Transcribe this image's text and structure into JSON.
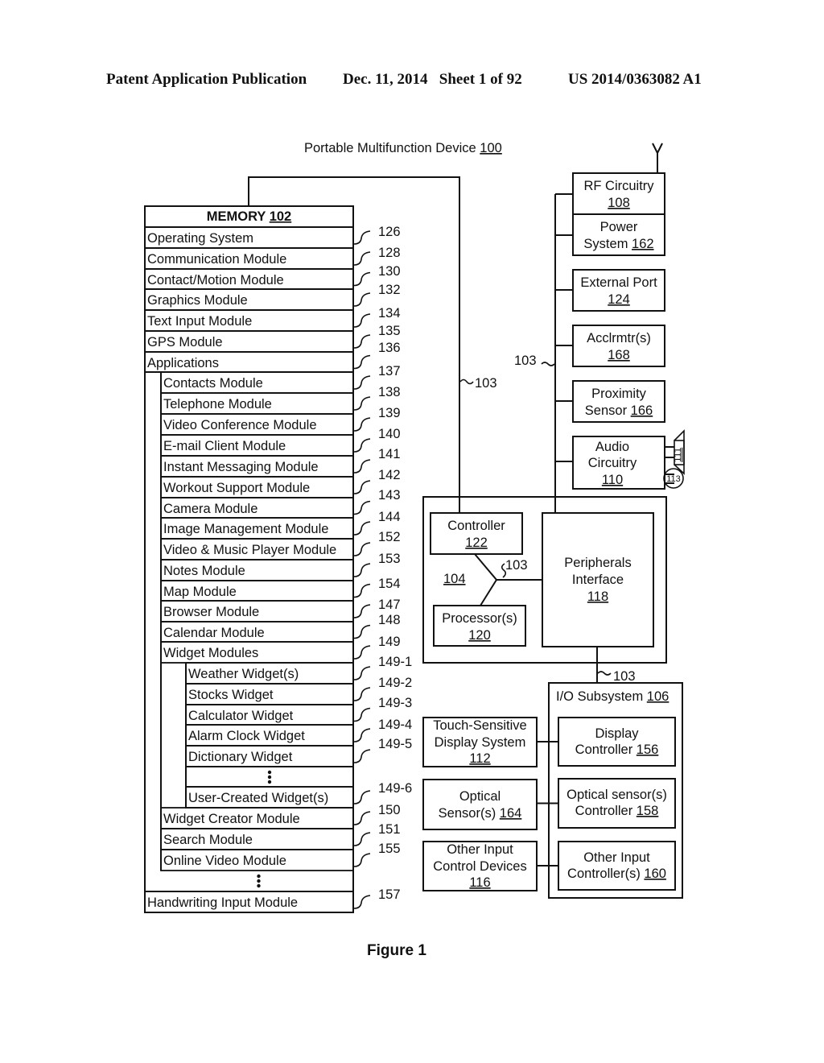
{
  "header": {
    "left": "Patent Application Publication",
    "date_sheet": "Dec. 11, 2014   Sheet 1 of 92",
    "pub_number": "US 2014/0363082 A1"
  },
  "diagram": {
    "title_text": "Portable Multifunction Device ",
    "title_ref": "100",
    "memory": {
      "title_text": "MEMORY ",
      "title_ref": "102",
      "rows": [
        {
          "label": "Operating System",
          "ref": "126",
          "level": 0
        },
        {
          "label": "Communication Module",
          "ref": "128",
          "level": 0
        },
        {
          "label": "Contact/Motion Module",
          "ref": "130",
          "level": 0
        },
        {
          "label": "Graphics Module",
          "ref": "132",
          "level": 0
        },
        {
          "label": "Text Input Module",
          "ref": "134",
          "level": 0
        },
        {
          "label": "GPS Module",
          "ref": "135",
          "level": 0
        },
        {
          "label": "Applications",
          "ref": "136",
          "level": 0
        },
        {
          "label": "Contacts Module",
          "ref": "137",
          "level": 1
        },
        {
          "label": "Telephone Module",
          "ref": "138",
          "level": 1
        },
        {
          "label": "Video Conference Module",
          "ref": "139",
          "level": 1
        },
        {
          "label": "E-mail Client Module",
          "ref": "140",
          "level": 1
        },
        {
          "label": "Instant Messaging Module",
          "ref": "141",
          "level": 1
        },
        {
          "label": "Workout Support Module",
          "ref": "142",
          "level": 1
        },
        {
          "label": "Camera Module",
          "ref": "143",
          "level": 1
        },
        {
          "label": "Image Management Module",
          "ref": "144",
          "level": 1
        },
        {
          "label": "Video & Music Player Module",
          "ref": "152",
          "level": 1
        },
        {
          "label": "Notes Module",
          "ref": "153",
          "level": 1
        },
        {
          "label": "Map Module",
          "ref": "154",
          "level": 1
        },
        {
          "label": "Browser Module",
          "ref": "147",
          "level": 1
        },
        {
          "label": "Calendar Module",
          "ref": "148",
          "level": 1
        },
        {
          "label": "Widget Modules",
          "ref": "149",
          "level": 1
        },
        {
          "label": "Weather Widget(s)",
          "ref": "149-1",
          "level": 2
        },
        {
          "label": "Stocks Widget",
          "ref": "149-2",
          "level": 2
        },
        {
          "label": "Calculator Widget",
          "ref": "149-3",
          "level": 2
        },
        {
          "label": "Alarm Clock Widget",
          "ref": "149-4",
          "level": 2
        },
        {
          "label": "Dictionary Widget",
          "ref": "149-5",
          "level": 2
        },
        {
          "label": "⋮",
          "ref": "",
          "level": 2
        },
        {
          "label": "User-Created Widget(s)",
          "ref": "149-6",
          "level": 2
        },
        {
          "label": "Widget Creator Module",
          "ref": "150",
          "level": 1
        },
        {
          "label": "Search Module",
          "ref": "151",
          "level": 1
        },
        {
          "label": "Online Video Module",
          "ref": "155",
          "level": 1
        },
        {
          "label": "⋮",
          "ref": "",
          "level": 0
        },
        {
          "label": "Handwriting Input Module",
          "ref": "157",
          "level": 0
        }
      ]
    },
    "right_column": [
      {
        "line1": "RF Circuitry",
        "line2_text": "",
        "line2_ref": "108"
      },
      {
        "line1": "Power",
        "line2_text": "System ",
        "line2_ref": "162"
      },
      {
        "line1": "External Port",
        "line2_text": "",
        "line2_ref": "124"
      },
      {
        "line1": "Acclrmtr(s)",
        "line2_text": "",
        "line2_ref": "168"
      },
      {
        "line1": "Proximity",
        "line2_text": "Sensor ",
        "line2_ref": "166"
      },
      {
        "line1": "Audio",
        "line2_text": "Circuitry",
        "line3_ref": "110"
      }
    ],
    "speaker_ref": "111",
    "microphone_ref": "113",
    "bus_ref": "103",
    "chip_ref": "104",
    "controller": {
      "label": "Controller",
      "ref": "122"
    },
    "processor": {
      "label": "Processor(s)",
      "ref": "120"
    },
    "peripherals": {
      "line1": "Peripherals",
      "line2": "Interface",
      "ref": "118"
    },
    "io_subsystem": {
      "label": "I/O Subsystem ",
      "ref": "106"
    },
    "io_controllers": [
      {
        "line1": "Display",
        "line2_text": "Controller ",
        "ref": "156"
      },
      {
        "line1": "Optical sensor(s)",
        "line2_text": "Controller ",
        "ref": "158"
      },
      {
        "line1": "Other Input",
        "line2_text": "Controller(s) ",
        "ref": "160"
      }
    ],
    "io_devices": [
      {
        "line1": "Touch-Sensitive",
        "line2": "Display System",
        "ref": "112"
      },
      {
        "line1": "Optical",
        "line2_text": "Sensor(s) ",
        "ref": "164"
      },
      {
        "line1": "Other Input",
        "line2": "Control Devices",
        "ref": "116"
      }
    ]
  },
  "caption": "Figure 1"
}
